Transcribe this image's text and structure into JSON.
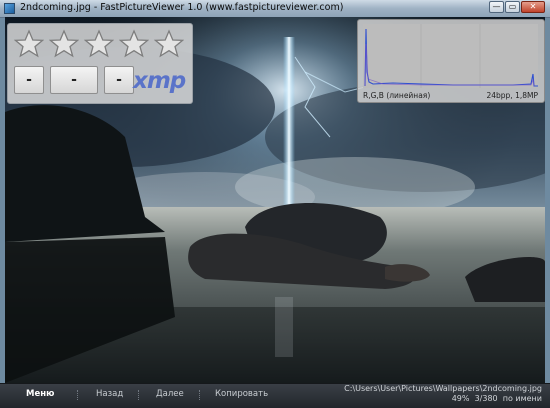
{
  "window": {
    "title": "2ndcoming.jpg - FastPictureViewer 1.0 (www.fastpictureviewer.com)",
    "min_glyph": "—",
    "max_glyph": "▭",
    "close_glyph": "✕"
  },
  "rating": {
    "star_count": 5,
    "stars_filled": 0,
    "buttons": [
      "-",
      "-",
      "-"
    ],
    "xmp_label": "xmp"
  },
  "histogram": {
    "left_label": "R,G,B (линейная)",
    "right_label": "24bpp, 1,8MP"
  },
  "menu": {
    "items": [
      "Меню",
      "Назад",
      "Далее",
      "Копировать"
    ]
  },
  "status": {
    "path": "C:\\Users\\User\\Pictures\\Wallpapers\\2ndcoming.jpg",
    "zoom": "49%",
    "position": "3/380",
    "sort": "по имени"
  },
  "colors": {
    "titlebar": "#9fb2c4",
    "overlay_panel": "#e1e1e1",
    "xmp": "#5a73c9",
    "histogram_line": "#2e4fd0",
    "bottombar": "#2a2e34"
  }
}
